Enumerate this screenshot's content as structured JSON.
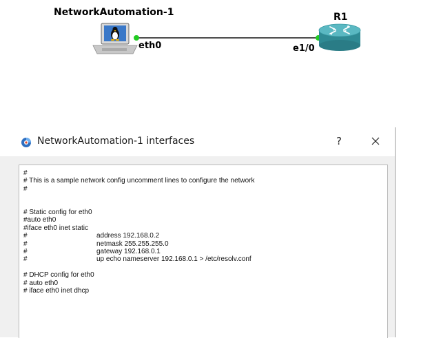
{
  "topology": {
    "host": {
      "name": "NetworkAutomation-1",
      "interface": "eth0",
      "icon": "linux-laptop-icon"
    },
    "router": {
      "name": "R1",
      "interface": "e1/0",
      "icon": "router-icon"
    },
    "link_status_color": "#22cc22"
  },
  "dialog": {
    "title": "NetworkAutomation-1 interfaces",
    "icon": "gns3-app-icon",
    "help_label": "?",
    "close_icon": "close-icon",
    "editor_lines": [
      {
        "prefix": "#",
        "text": ""
      },
      {
        "prefix": "# This is a sample network config uncomment lines to configure the network",
        "text": ""
      },
      {
        "prefix": "#",
        "text": ""
      },
      {
        "prefix": "",
        "text": ""
      },
      {
        "prefix": "",
        "text": ""
      },
      {
        "prefix": "# Static config for eth0",
        "text": ""
      },
      {
        "prefix": "#auto eth0",
        "text": ""
      },
      {
        "prefix": "#iface eth0 inet static",
        "text": ""
      },
      {
        "prefix": "#",
        "text": "address 192.168.0.2"
      },
      {
        "prefix": "#",
        "text": "netmask 255.255.255.0"
      },
      {
        "prefix": "#",
        "text": "gateway 192.168.0.1"
      },
      {
        "prefix": "#",
        "text": "up echo nameserver 192.168.0.1 > /etc/resolv.conf"
      },
      {
        "prefix": "",
        "text": ""
      },
      {
        "prefix": "# DHCP config for eth0",
        "text": ""
      },
      {
        "prefix": "# auto eth0",
        "text": ""
      },
      {
        "prefix": "# iface eth0 inet dhcp",
        "text": ""
      }
    ]
  }
}
